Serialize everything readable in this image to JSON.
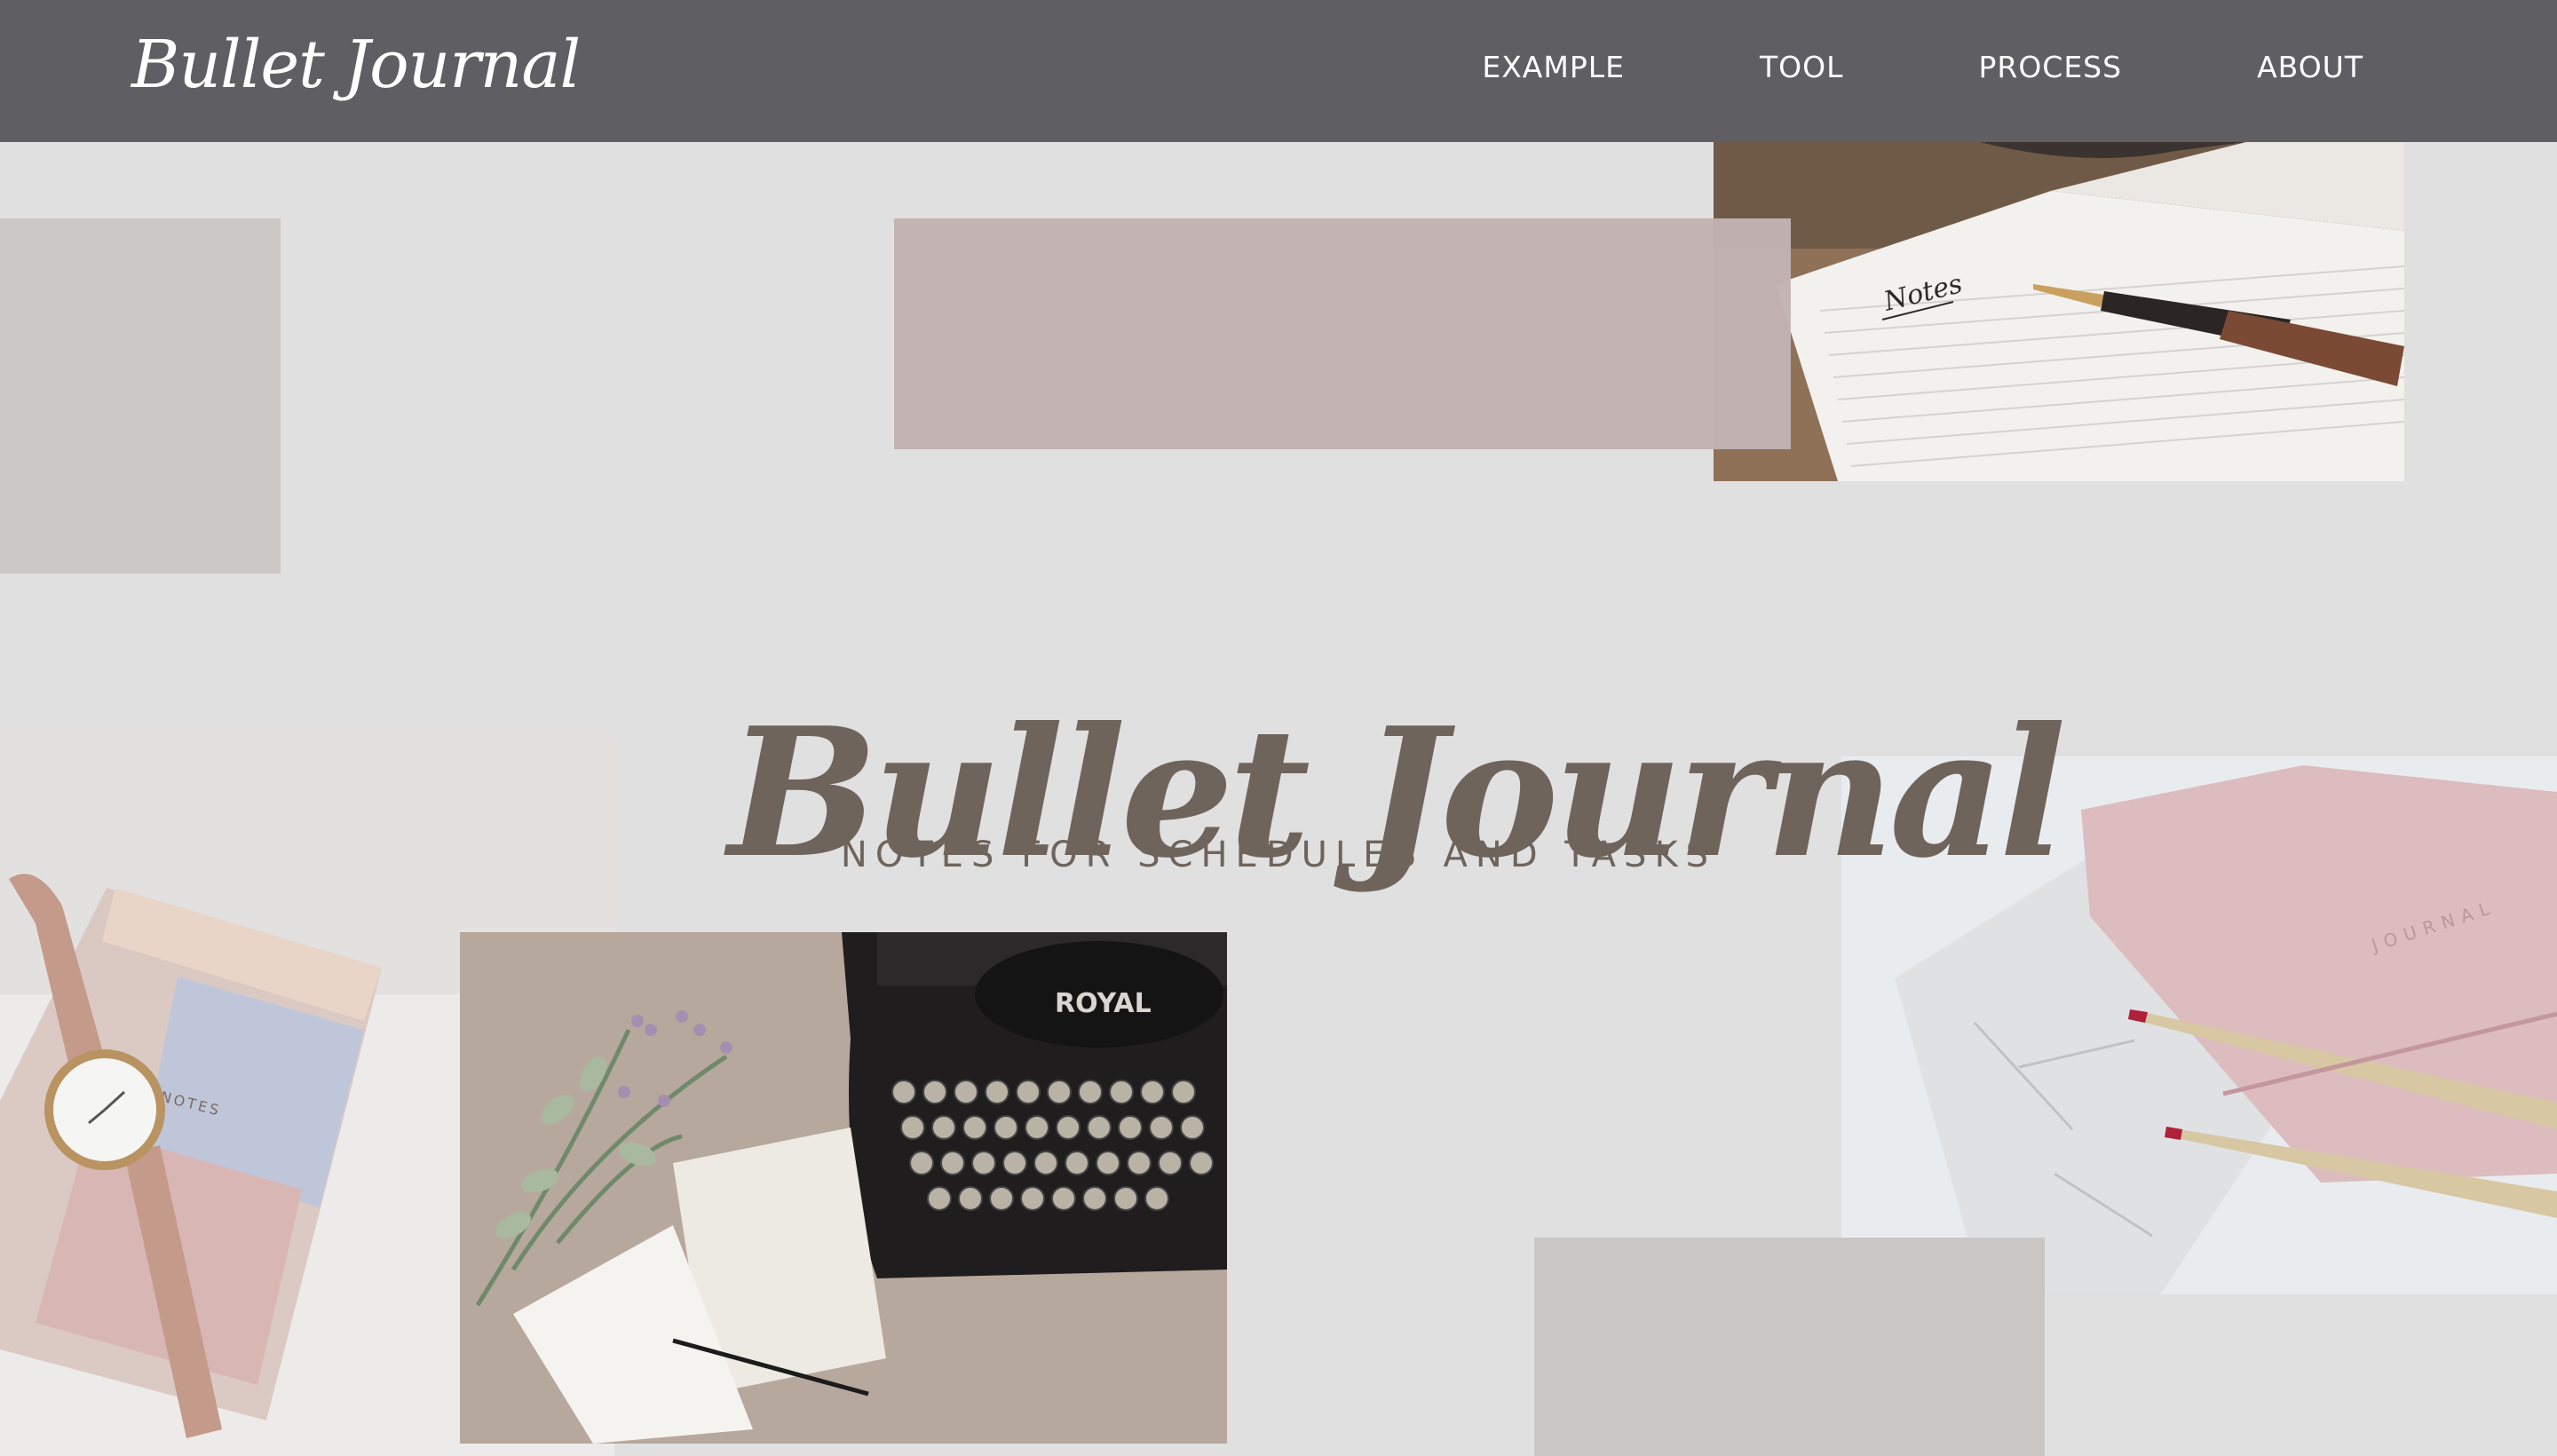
{
  "header": {
    "brand": "Bullet Journal",
    "nav": [
      {
        "label": "EXAMPLE"
      },
      {
        "label": "TOOL"
      },
      {
        "label": "PROCESS"
      },
      {
        "label": "ABOUT"
      }
    ]
  },
  "hero": {
    "title": "Bullet Journal",
    "subtitle": "NOTES FOR SCHEDULES AND TASKS"
  },
  "photos": {
    "notes_text": "Notes",
    "watch_notebook_text": "NOTES",
    "typewriter_brand": "ROYAL",
    "journal_cover_text": "JOURNAL"
  },
  "colors": {
    "header_bg": "#5f5f63",
    "page_bg": "#e0e0e0",
    "accent_mauve": "#c2b3b3",
    "accent_gray": "#cbc8c6",
    "title_color": "#6e645c"
  }
}
